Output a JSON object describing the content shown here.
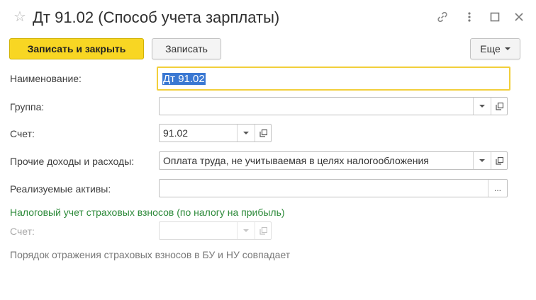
{
  "window": {
    "title": "Дт 91.02 (Способ учета зарплаты)"
  },
  "toolbar": {
    "save_close_label": "Записать и закрыть",
    "save_label": "Записать",
    "more_label": "Еще"
  },
  "form": {
    "name_label": "Наименование:",
    "name_value": "Дт 91.02",
    "group_label": "Группа:",
    "group_value": "",
    "account_label": "Счет:",
    "account_value": "91.02",
    "other_label": "Прочие доходы и расходы:",
    "other_value": "Оплата труда, не учитываемая в целях налогообложения",
    "assets_label": "Реализуемые активы:",
    "assets_value": "",
    "assets_button": "..."
  },
  "tax_section": {
    "title": "Налоговый учет страховых взносов (по налогу на прибыль)",
    "account_label": "Счет:",
    "account_value": "",
    "note": "Порядок отражения страховых взносов в БУ и НУ совпадает"
  },
  "colors": {
    "primary_button": "#f8d623",
    "focus_border": "#f2cf3b",
    "section_title": "#2d8a3a",
    "selection": "#3a78d2"
  },
  "icons": [
    "star-icon",
    "link-icon",
    "more-vertical-icon",
    "maximize-icon",
    "close-icon",
    "chevron-down-icon",
    "open-icon"
  ]
}
